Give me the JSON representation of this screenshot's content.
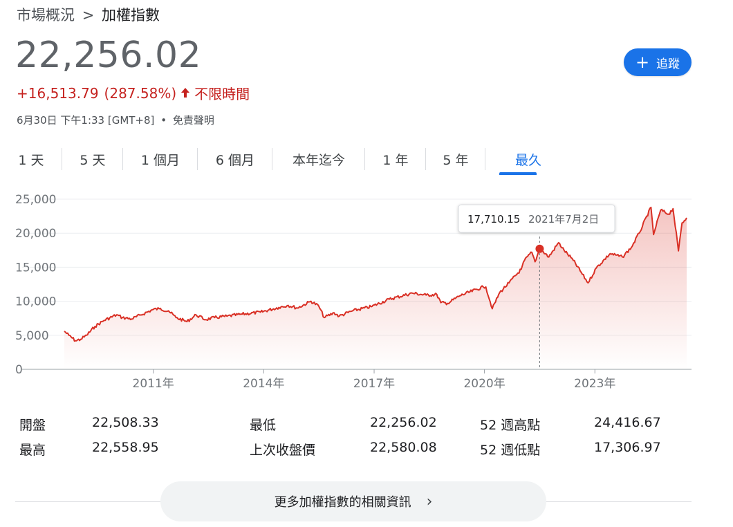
{
  "breadcrumb": {
    "parent": "市場概況",
    "separator": ">",
    "current": "加權指數"
  },
  "quote": {
    "price": "22,256.02",
    "change": "+16,513.79",
    "change_percent": "(287.58%)",
    "direction_icon": "arrow-up-icon",
    "period": "不限時間",
    "timestamp": "6月30日 下午1:33 [GMT+8]",
    "dot": "•",
    "disclaimer": "免責聲明",
    "color_down": "#c5221f"
  },
  "follow_button": {
    "icon": "plus-icon",
    "plus": "+",
    "label": "追蹤",
    "color": "#1a73e8"
  },
  "tabs": [
    {
      "label": "1 天",
      "active": false
    },
    {
      "label": "5 天",
      "active": false
    },
    {
      "label": "1 個月",
      "active": false
    },
    {
      "label": "6 個月",
      "active": false
    },
    {
      "label": "本年迄今",
      "active": false
    },
    {
      "label": "1 年",
      "active": false
    },
    {
      "label": "5 年",
      "active": false
    },
    {
      "label": "最久",
      "active": true
    }
  ],
  "chart_data": {
    "type": "area",
    "x_start": "2008-08-01",
    "x_end": "2025-06-30",
    "ylim": [
      0,
      25000
    ],
    "y_ticks": [
      "0",
      "5,000",
      "10,000",
      "15,000",
      "20,000",
      "25,000"
    ],
    "y_tick_values": [
      0,
      5000,
      10000,
      15000,
      20000,
      25000
    ],
    "x_ticks": [
      "2011年",
      "2014年",
      "2017年",
      "2020年",
      "2023年"
    ],
    "x_tick_dates": [
      "2011-01-01",
      "2014-01-01",
      "2017-01-01",
      "2020-01-01",
      "2023-01-01"
    ],
    "grid": true,
    "line_color": "#d93025",
    "series": [
      {
        "points": [
          [
            "2008-08-01",
            5600
          ],
          [
            "2008-09-15",
            5000
          ],
          [
            "2008-11-20",
            4200
          ],
          [
            "2009-01-10",
            4400
          ],
          [
            "2009-03-10",
            5000
          ],
          [
            "2009-06-01",
            6300
          ],
          [
            "2009-09-01",
            7200
          ],
          [
            "2010-01-01",
            8000
          ],
          [
            "2010-03-01",
            7600
          ],
          [
            "2010-06-01",
            7400
          ],
          [
            "2010-09-01",
            8000
          ],
          [
            "2011-01-01",
            8800
          ],
          [
            "2011-03-01",
            8900
          ],
          [
            "2011-06-01",
            8600
          ],
          [
            "2011-08-15",
            7600
          ],
          [
            "2011-12-01",
            7000
          ],
          [
            "2012-03-01",
            8000
          ],
          [
            "2012-06-01",
            7300
          ],
          [
            "2012-09-01",
            7600
          ],
          [
            "2013-01-01",
            7800
          ],
          [
            "2013-06-01",
            8100
          ],
          [
            "2013-12-01",
            8400
          ],
          [
            "2014-06-01",
            9100
          ],
          [
            "2014-09-01",
            9400
          ],
          [
            "2014-12-01",
            9000
          ],
          [
            "2015-04-15",
            10000
          ],
          [
            "2015-07-01",
            9300
          ],
          [
            "2015-08-25",
            7600
          ],
          [
            "2015-12-01",
            8300
          ],
          [
            "2016-01-20",
            7800
          ],
          [
            "2016-06-01",
            8600
          ],
          [
            "2016-12-01",
            9200
          ],
          [
            "2017-06-01",
            10300
          ],
          [
            "2018-01-15",
            11200
          ],
          [
            "2018-06-01",
            10900
          ],
          [
            "2018-09-15",
            11000
          ],
          [
            "2018-10-25",
            9800
          ],
          [
            "2019-01-01",
            9700
          ],
          [
            "2019-05-01",
            10800
          ],
          [
            "2019-12-20",
            12100
          ],
          [
            "2020-01-15",
            12100
          ],
          [
            "2020-03-19",
            8900
          ],
          [
            "2020-06-01",
            11300
          ],
          [
            "2020-09-01",
            12700
          ],
          [
            "2020-12-31",
            14700
          ],
          [
            "2021-02-01",
            16000
          ],
          [
            "2021-04-15",
            17200
          ],
          [
            "2021-05-17",
            15800
          ],
          [
            "2021-07-02",
            17710.15
          ],
          [
            "2021-10-01",
            16500
          ],
          [
            "2022-01-05",
            18600
          ],
          [
            "2022-03-01",
            17500
          ],
          [
            "2022-06-01",
            16000
          ],
          [
            "2022-10-25",
            12700
          ],
          [
            "2023-01-15",
            14900
          ],
          [
            "2023-06-01",
            17000
          ],
          [
            "2023-10-01",
            16500
          ],
          [
            "2023-12-29",
            17900
          ],
          [
            "2024-03-15",
            20000
          ],
          [
            "2024-07-11",
            23800
          ],
          [
            "2024-08-05",
            19800
          ],
          [
            "2024-10-15",
            23400
          ],
          [
            "2025-01-02",
            22800
          ],
          [
            "2025-02-15",
            23600
          ],
          [
            "2025-04-09",
            17400
          ],
          [
            "2025-05-15",
            21500
          ],
          [
            "2025-06-30",
            22256.02
          ]
        ]
      }
    ],
    "tooltip": {
      "value": "17,710.15",
      "date": "2021年7月2日",
      "at": "2021-07-02",
      "at_value": 17710.15
    }
  },
  "stats": [
    {
      "label": "開盤",
      "value": "22,508.33"
    },
    {
      "label": "最高",
      "value": "22,558.95"
    },
    {
      "label": "最低",
      "value": "22,256.02"
    },
    {
      "label": "上次收盤價",
      "value": "22,580.08"
    },
    {
      "label": "52 週高點",
      "value": "24,416.67"
    },
    {
      "label": "52 週低點",
      "value": "17,306.97"
    }
  ],
  "more_button": {
    "label": "更多加權指數的相關資訊",
    "icon": "chevron-right-icon",
    "chevron": "›"
  }
}
